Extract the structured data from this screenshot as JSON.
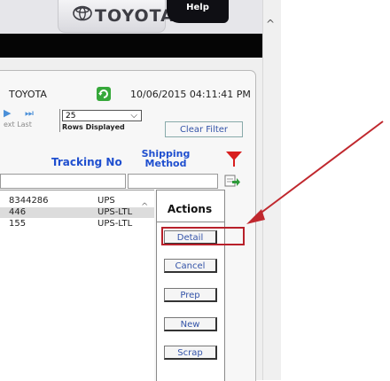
{
  "header": {
    "brand": "TOYOTA",
    "help_label": "Help"
  },
  "toolbar": {
    "company": "TOYOTA",
    "timestamp": "10/06/2015 04:11:41 PM",
    "pager_labels": "ext  Last",
    "rows_per_page": "25",
    "rows_label": "Rows Displayed",
    "clear_filter": "Clear Filter"
  },
  "columns": {
    "tracking": "Tracking No",
    "shipping": "Shipping Method"
  },
  "rows": [
    {
      "tracking": "8344286",
      "method": "UPS"
    },
    {
      "tracking": "446",
      "method": "UPS-LTL"
    },
    {
      "tracking": "155",
      "method": "UPS-LTL"
    }
  ],
  "actions": {
    "title": "Actions",
    "buttons": [
      "Detail",
      "Cancel",
      "Prep",
      "New",
      "Scrap"
    ]
  },
  "colors": {
    "highlight": "#b8202a",
    "link_blue": "#1f4fcf"
  }
}
